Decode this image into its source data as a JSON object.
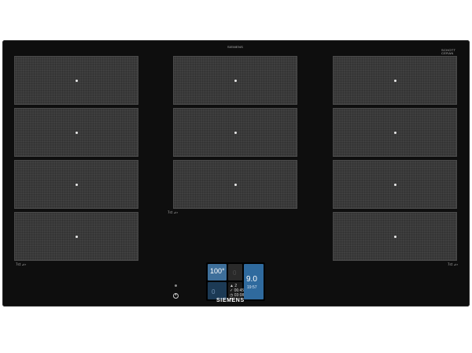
{
  "hob": {
    "top_marking": "SIEMENS",
    "badge_lines": [
      "SCHOTT",
      "CERAN"
    ],
    "left_markers": "7st ⊿∙",
    "center_markers": "7st ⊿∙",
    "right_markers": "7st ⊿∙",
    "brand": "SIEMENS"
  },
  "zones": {
    "left": [
      "zone",
      "zone",
      "zone",
      "zone"
    ],
    "center": [
      "zone",
      "zone",
      "zone"
    ],
    "right": [
      "zone",
      "zone",
      "zone",
      "zone"
    ]
  },
  "display": {
    "temperature": "100°",
    "empty_digit": "0",
    "lower_digit": "0",
    "info_count": "2",
    "info_time_1": "06:45",
    "info_time_2": "03:08",
    "power_level": "9.0",
    "power_time": "19:57",
    "caret": "^"
  },
  "colors": {
    "glass": "#0e0e0e",
    "zone": "#3a3a3a",
    "tile_blue": "#3e6f9a",
    "tile_dark_blue": "#1c3a55"
  }
}
